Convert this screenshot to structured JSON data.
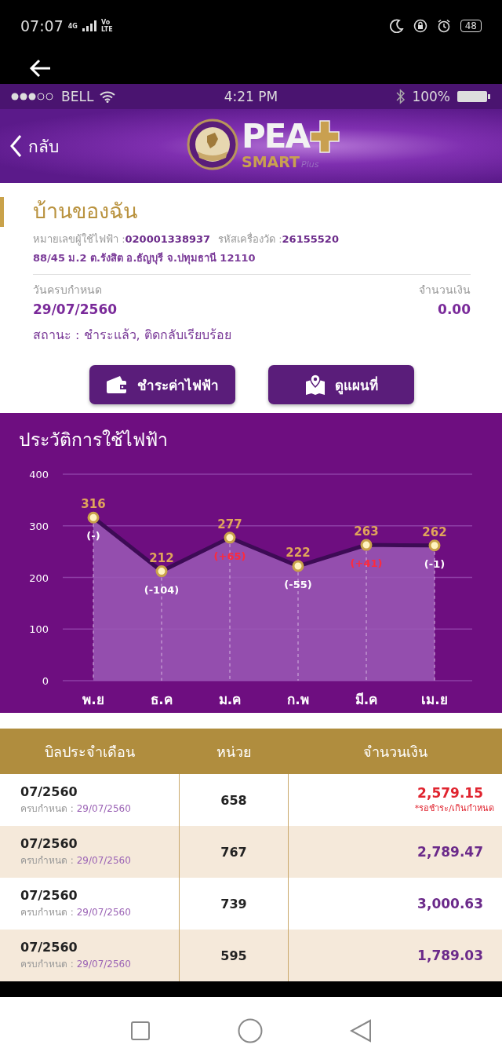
{
  "system_bar": {
    "time": "07:07",
    "network": "4G",
    "volte": "Vo LTE",
    "battery": "48"
  },
  "inner_status_bar": {
    "carrier": "BELL",
    "time": "4:21 PM",
    "battery": "100%"
  },
  "header": {
    "back_label": "กลับ",
    "logo": [
      "PEA",
      "SMART",
      "Plus"
    ]
  },
  "account": {
    "name": "บ้านของฉัน",
    "customer_label": "หมายเลขผู้ใช้ไฟฟ้า :",
    "customer_no": "020001338937",
    "meter_label": "รหัสเครื่องวัด :",
    "meter_no": "26155520",
    "address": "88/45 ม.2 ต.รังสิต อ.ธัญบุรี จ.ปทุมธานี 12110",
    "due_label": "วันครบกำหนด",
    "due_date": "29/07/2560",
    "amount_label": "จำนวนเงิน",
    "amount": "0.00",
    "status": "สถานะ : ชำระแล้ว, ติดกลับเรียบร้อย"
  },
  "actions": [
    {
      "label": "ชำระค่าไฟฟ้า",
      "kind": "pay"
    },
    {
      "label": "ดูแผนที่",
      "kind": "map"
    }
  ],
  "usage_history": {
    "title": "ประวัติการใช้ไฟฟ้า",
    "chart_data": {
      "type": "area",
      "categories": [
        "พ.ย",
        "ธ.ค",
        "ม.ค",
        "ก.พ",
        "มี.ค",
        "เม.ย"
      ],
      "series": [
        {
          "color": "#9b59b6",
          "values": [
            316,
            212,
            277,
            222,
            263,
            262
          ]
        }
      ],
      "ylim": [
        0,
        400
      ],
      "yticks": [
        0,
        100,
        200,
        300,
        400
      ],
      "data_labels": true,
      "grid": true
    },
    "changes": [
      {
        "text": "(-)",
        "kind": "fall"
      },
      {
        "text": "(-104)",
        "kind": "fall"
      },
      {
        "text": "(+65)",
        "kind": "rise"
      },
      {
        "text": "(-55)",
        "kind": "fall"
      },
      {
        "text": "(+41)",
        "kind": "rise"
      },
      {
        "text": "(-1)",
        "kind": "fall"
      }
    ]
  },
  "bills": {
    "columns": [
      "บิลประจำเดือน",
      "หน่วย",
      "จำนวนเงิน"
    ],
    "rows": [
      {
        "month": "07/2560",
        "due_label": "ครบกำหนด :",
        "due_date": "29/07/2560",
        "units": "658",
        "amount": "2,579.15",
        "overdue": true,
        "note": "*รอชำระ/เกินกำหนด"
      },
      {
        "month": "07/2560",
        "due_label": "ครบกำหนด :",
        "due_date": "29/07/2560",
        "units": "767",
        "amount": "2,789.47",
        "overdue": false
      },
      {
        "month": "07/2560",
        "due_label": "ครบกำหนด :",
        "due_date": "29/07/2560",
        "units": "739",
        "amount": "3,000.63",
        "overdue": false
      },
      {
        "month": "07/2560",
        "due_label": "ครบกำหนด :",
        "due_date": "29/07/2560",
        "units": "595",
        "amount": "1,789.03",
        "overdue": false
      }
    ]
  }
}
